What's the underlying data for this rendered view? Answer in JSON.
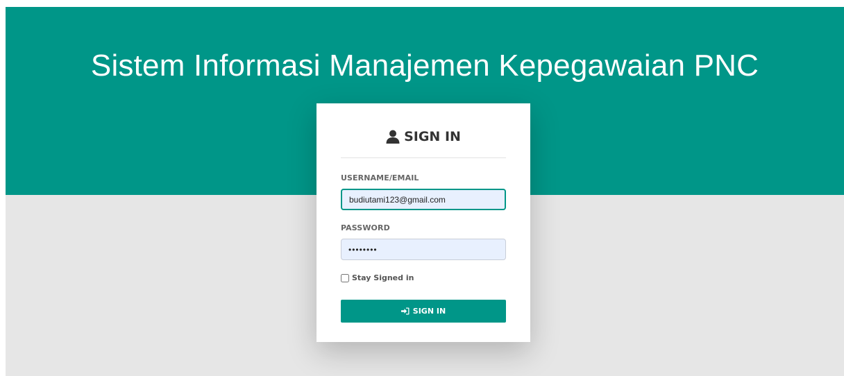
{
  "app": {
    "title": "Sistem Informasi Manajemen Kepegawaian PNC"
  },
  "login": {
    "heading": "SIGN IN",
    "heading_icon": "user-icon",
    "username_label": "USERNAME/EMAIL",
    "username_value": "budiutami123@gmail.com",
    "password_label": "PASSWORD",
    "password_value": "budi1234",
    "remember_label": "Stay Signed in",
    "remember_checked": false,
    "submit_label": "SIGN IN",
    "submit_icon": "sign-in-icon"
  },
  "colors": {
    "accent": "#009688",
    "background": "#e6e6e6",
    "input_fill": "#e8f0fe"
  }
}
